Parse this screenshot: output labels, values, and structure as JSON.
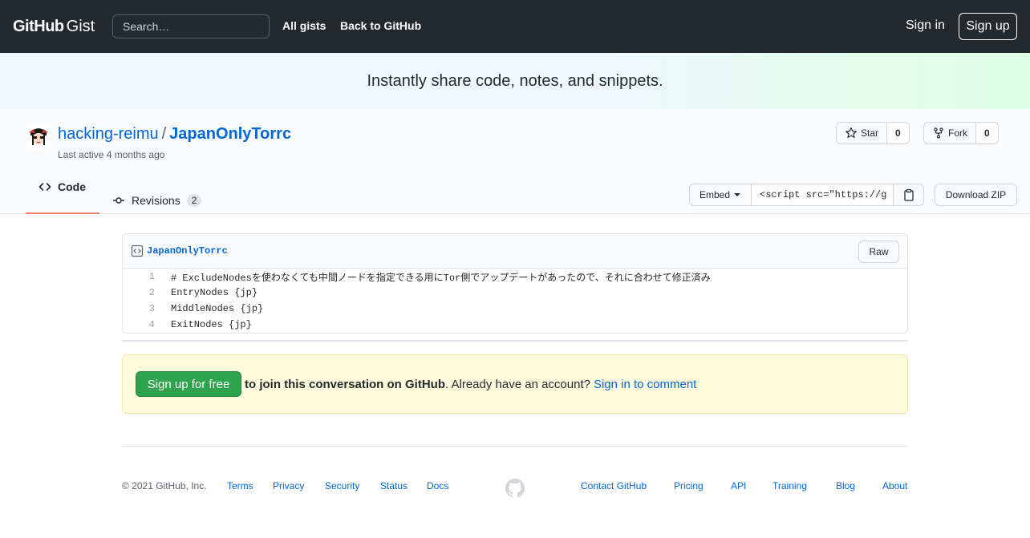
{
  "header": {
    "logo_main": "GitHub",
    "logo_sub": "Gist",
    "search_placeholder": "Search…",
    "nav_all_gists": "All gists",
    "nav_back": "Back to GitHub",
    "sign_in": "Sign in",
    "sign_up": "Sign up"
  },
  "banner": {
    "text": "Instantly share code, notes, and snippets."
  },
  "gist": {
    "owner": "hacking-reimu",
    "separator": "/",
    "name": "JapanOnlyTorrc",
    "last_active": "Last active 4 months ago",
    "star_label": "Star",
    "star_count": "0",
    "fork_label": "Fork",
    "fork_count": "0",
    "tabs": {
      "code": "Code",
      "revisions": "Revisions",
      "revisions_count": "2"
    },
    "embed_label": "Embed",
    "embed_value": "<script src=\"https://g",
    "download_zip": "Download ZIP"
  },
  "file": {
    "name": "JapanOnlyTorrc",
    "raw_label": "Raw",
    "lines": [
      {
        "num": "1",
        "text": "# ExcludeNodesを使わなくても中間ノードを指定できる用にTor側でアップデートがあったので、それに合わせて修正済み"
      },
      {
        "num": "2",
        "text": "EntryNodes {jp}"
      },
      {
        "num": "3",
        "text": "MiddleNodes {jp}"
      },
      {
        "num": "4",
        "text": "ExitNodes {jp}"
      }
    ]
  },
  "conversation": {
    "signup_button": "Sign up for free",
    "join_text": "to join this conversation on GitHub",
    "already_text": ". Already have an account?",
    "signin_comment": "Sign in to comment"
  },
  "footer": {
    "copyright": "© 2021 GitHub, Inc.",
    "left_links": [
      "Terms",
      "Privacy",
      "Security",
      "Status",
      "Docs"
    ],
    "right_links": [
      "Contact GitHub",
      "Pricing",
      "API",
      "Training",
      "Blog",
      "About"
    ]
  },
  "colors": {
    "header_bg": "#24292e",
    "link": "#0366d6",
    "signup_green": "#2ea44f",
    "tab_underline": "#f9826c",
    "convo_bg": "#fffbdd"
  }
}
